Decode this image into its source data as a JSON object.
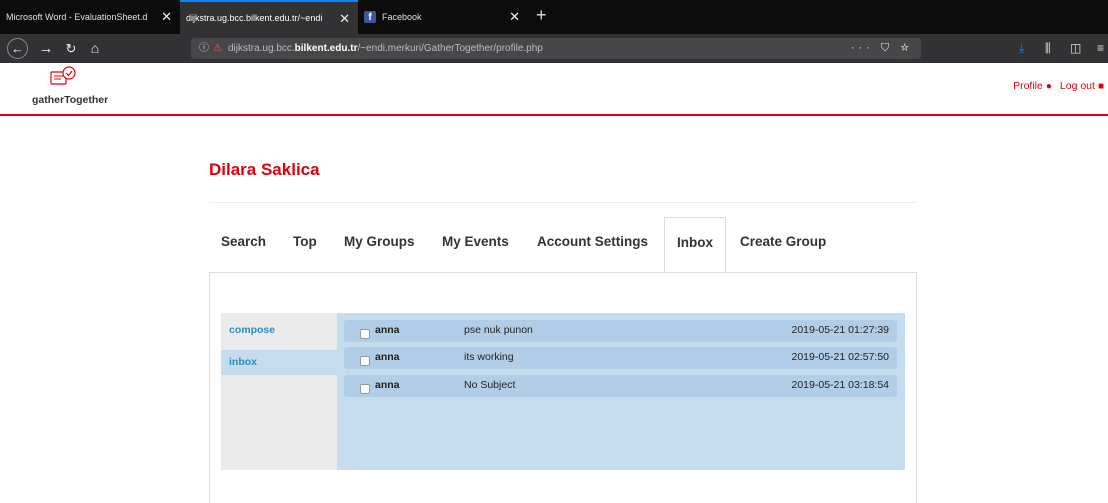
{
  "browser": {
    "tabs": [
      {
        "title": "Microsoft Word - EvaluationSheet.d",
        "active": false
      },
      {
        "title": "dijkstra.ug.bcc.bilkent.edu.tr/~endi",
        "active": true
      },
      {
        "title": "Facebook",
        "active": false
      }
    ],
    "url_prefix": "dijkstra.ug.bcc.",
    "url_domain": "bilkent.edu.tr",
    "url_suffix": "/~endi.merkuri/GatherTogether/profile.php",
    "url_actions": "··· ⛉ ☆",
    "icons": [
      "back-icon",
      "forward-icon",
      "reload-icon",
      "home-icon",
      "info-icon",
      "insecure-icon",
      "download-icon",
      "library-icon",
      "sidebar-icon",
      "menu-icon"
    ]
  },
  "site": {
    "logo_text": "gatherTogether",
    "profile_link": "Profile",
    "logout_link": "Log out",
    "accent_color": "#e0000f"
  },
  "profile": {
    "name": "Dilara Saklica"
  },
  "nav_tabs": [
    "Search",
    "Top",
    "My Groups",
    "My Events",
    "Account Settings",
    "Inbox",
    "Create Group"
  ],
  "active_tab": "Inbox",
  "mailbox": {
    "sidebar": [
      {
        "label": "compose",
        "active": false
      },
      {
        "label": "inbox",
        "active": true
      }
    ],
    "messages": [
      {
        "from": "anna",
        "subject": "pse nuk punon",
        "date": "2019-05-21 01:27:39"
      },
      {
        "from": "anna",
        "subject": "its working",
        "date": "2019-05-21 02:57:50"
      },
      {
        "from": "anna",
        "subject": "No Subject",
        "date": "2019-05-21 03:18:54"
      }
    ]
  }
}
